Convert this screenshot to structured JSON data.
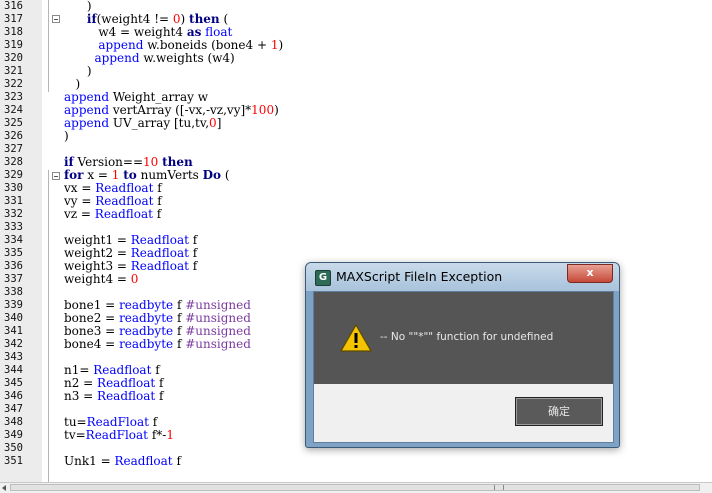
{
  "editor": {
    "lines": [
      {
        "n": "316",
        "segs": [
          {
            "t": "      )",
            "c": ""
          }
        ]
      },
      {
        "n": "317",
        "segs": [
          {
            "t": "      ",
            "c": ""
          },
          {
            "t": "if",
            "c": "kw"
          },
          {
            "t": "(weight4 != ",
            "c": ""
          },
          {
            "t": "0",
            "c": "num"
          },
          {
            "t": ") ",
            "c": ""
          },
          {
            "t": "then",
            "c": "kw"
          },
          {
            "t": " (",
            "c": ""
          }
        ]
      },
      {
        "n": "318",
        "segs": [
          {
            "t": "         w4 = weight4 ",
            "c": ""
          },
          {
            "t": "as",
            "c": "kw"
          },
          {
            "t": " ",
            "c": ""
          },
          {
            "t": "float",
            "c": "fn"
          }
        ]
      },
      {
        "n": "319",
        "segs": [
          {
            "t": "         ",
            "c": ""
          },
          {
            "t": "append",
            "c": "fn"
          },
          {
            "t": " w.boneids (bone4 + ",
            "c": ""
          },
          {
            "t": "1",
            "c": "num"
          },
          {
            "t": ")",
            "c": ""
          }
        ]
      },
      {
        "n": "320",
        "segs": [
          {
            "t": "        ",
            "c": ""
          },
          {
            "t": "append",
            "c": "fn"
          },
          {
            "t": " w.weights (w4)",
            "c": ""
          }
        ]
      },
      {
        "n": "321",
        "segs": [
          {
            "t": "      )",
            "c": ""
          }
        ]
      },
      {
        "n": "322",
        "segs": [
          {
            "t": "   )",
            "c": ""
          }
        ]
      },
      {
        "n": "323",
        "segs": [
          {
            "t": "append",
            "c": "fn"
          },
          {
            "t": " Weight_array w",
            "c": ""
          }
        ]
      },
      {
        "n": "324",
        "segs": [
          {
            "t": "append",
            "c": "fn"
          },
          {
            "t": " vertArray ([-vx,-vz,vy]*",
            "c": ""
          },
          {
            "t": "100",
            "c": "num"
          },
          {
            "t": ")",
            "c": ""
          }
        ]
      },
      {
        "n": "325",
        "segs": [
          {
            "t": "append",
            "c": "fn"
          },
          {
            "t": " UV_array [tu,tv,",
            "c": ""
          },
          {
            "t": "0",
            "c": "num"
          },
          {
            "t": "]",
            "c": ""
          }
        ]
      },
      {
        "n": "326",
        "segs": [
          {
            "t": ")",
            "c": ""
          }
        ]
      },
      {
        "n": "327",
        "segs": []
      },
      {
        "n": "328",
        "segs": [
          {
            "t": "if",
            "c": "kw"
          },
          {
            "t": " Version==",
            "c": ""
          },
          {
            "t": "10",
            "c": "num"
          },
          {
            "t": " ",
            "c": ""
          },
          {
            "t": "then",
            "c": "kw"
          }
        ]
      },
      {
        "n": "329",
        "segs": [
          {
            "t": "for",
            "c": "kw"
          },
          {
            "t": " x = ",
            "c": ""
          },
          {
            "t": "1",
            "c": "num"
          },
          {
            "t": " ",
            "c": ""
          },
          {
            "t": "to",
            "c": "kw"
          },
          {
            "t": " numVerts ",
            "c": ""
          },
          {
            "t": "Do",
            "c": "kw"
          },
          {
            "t": " (",
            "c": ""
          }
        ]
      },
      {
        "n": "330",
        "segs": [
          {
            "t": "vx = ",
            "c": ""
          },
          {
            "t": "Readfloat",
            "c": "fn"
          },
          {
            "t": " f",
            "c": ""
          }
        ]
      },
      {
        "n": "331",
        "segs": [
          {
            "t": "vy = ",
            "c": ""
          },
          {
            "t": "Readfloat",
            "c": "fn"
          },
          {
            "t": " f",
            "c": ""
          }
        ]
      },
      {
        "n": "332",
        "segs": [
          {
            "t": "vz = ",
            "c": ""
          },
          {
            "t": "Readfloat",
            "c": "fn"
          },
          {
            "t": " f",
            "c": ""
          }
        ]
      },
      {
        "n": "333",
        "segs": []
      },
      {
        "n": "334",
        "segs": [
          {
            "t": "weight1 = ",
            "c": ""
          },
          {
            "t": "Readfloat",
            "c": "fn"
          },
          {
            "t": " f",
            "c": ""
          }
        ]
      },
      {
        "n": "335",
        "segs": [
          {
            "t": "weight2 = ",
            "c": ""
          },
          {
            "t": "Readfloat",
            "c": "fn"
          },
          {
            "t": " f",
            "c": ""
          }
        ]
      },
      {
        "n": "336",
        "segs": [
          {
            "t": "weight3 = ",
            "c": ""
          },
          {
            "t": "Readfloat",
            "c": "fn"
          },
          {
            "t": " f",
            "c": ""
          }
        ]
      },
      {
        "n": "337",
        "segs": [
          {
            "t": "weight4 = ",
            "c": ""
          },
          {
            "t": "0",
            "c": "num"
          }
        ]
      },
      {
        "n": "338",
        "segs": []
      },
      {
        "n": "339",
        "segs": [
          {
            "t": "bone1 = ",
            "c": ""
          },
          {
            "t": "readbyte",
            "c": "fn"
          },
          {
            "t": " f ",
            "c": ""
          },
          {
            "t": "#unsigned",
            "c": "str"
          }
        ]
      },
      {
        "n": "340",
        "segs": [
          {
            "t": "bone2 = ",
            "c": ""
          },
          {
            "t": "readbyte",
            "c": "fn"
          },
          {
            "t": " f ",
            "c": ""
          },
          {
            "t": "#unsigned",
            "c": "str"
          }
        ]
      },
      {
        "n": "341",
        "segs": [
          {
            "t": "bone3 = ",
            "c": ""
          },
          {
            "t": "readbyte",
            "c": "fn"
          },
          {
            "t": " f ",
            "c": ""
          },
          {
            "t": "#unsigned",
            "c": "str"
          }
        ]
      },
      {
        "n": "342",
        "segs": [
          {
            "t": "bone4 = ",
            "c": ""
          },
          {
            "t": "readbyte",
            "c": "fn"
          },
          {
            "t": " f ",
            "c": ""
          },
          {
            "t": "#unsigned",
            "c": "str"
          }
        ]
      },
      {
        "n": "343",
        "segs": []
      },
      {
        "n": "344",
        "segs": [
          {
            "t": "n1= ",
            "c": ""
          },
          {
            "t": "Readfloat",
            "c": "fn"
          },
          {
            "t": " f",
            "c": ""
          }
        ]
      },
      {
        "n": "345",
        "segs": [
          {
            "t": "n2 = ",
            "c": ""
          },
          {
            "t": "Readfloat",
            "c": "fn"
          },
          {
            "t": " f",
            "c": ""
          }
        ]
      },
      {
        "n": "346",
        "segs": [
          {
            "t": "n3 = ",
            "c": ""
          },
          {
            "t": "Readfloat",
            "c": "fn"
          },
          {
            "t": " f",
            "c": ""
          }
        ]
      },
      {
        "n": "347",
        "segs": []
      },
      {
        "n": "348",
        "segs": [
          {
            "t": "tu=",
            "c": ""
          },
          {
            "t": "ReadFloat",
            "c": "fn"
          },
          {
            "t": " f",
            "c": ""
          }
        ]
      },
      {
        "n": "349",
        "segs": [
          {
            "t": "tv=",
            "c": ""
          },
          {
            "t": "ReadFloat",
            "c": "fn"
          },
          {
            "t": " f*-",
            "c": ""
          },
          {
            "t": "1",
            "c": "num"
          }
        ]
      },
      {
        "n": "350",
        "segs": []
      },
      {
        "n": "351",
        "segs": [
          {
            "t": "Unk1 = ",
            "c": ""
          },
          {
            "t": "Readfloat",
            "c": "fn"
          },
          {
            "t": " f",
            "c": ""
          }
        ]
      }
    ]
  },
  "dialog": {
    "title": "MAXScript FileIn Exception",
    "close_label": "x",
    "app_icon": "G",
    "message": "-- No \"\"*\"\" function for undefined",
    "icon": "warning-icon",
    "ok_label": "确定"
  },
  "colors": {
    "keyword": "#000080",
    "function": "#0000ff",
    "number": "#ff0000",
    "name": "#7a3aa0"
  }
}
